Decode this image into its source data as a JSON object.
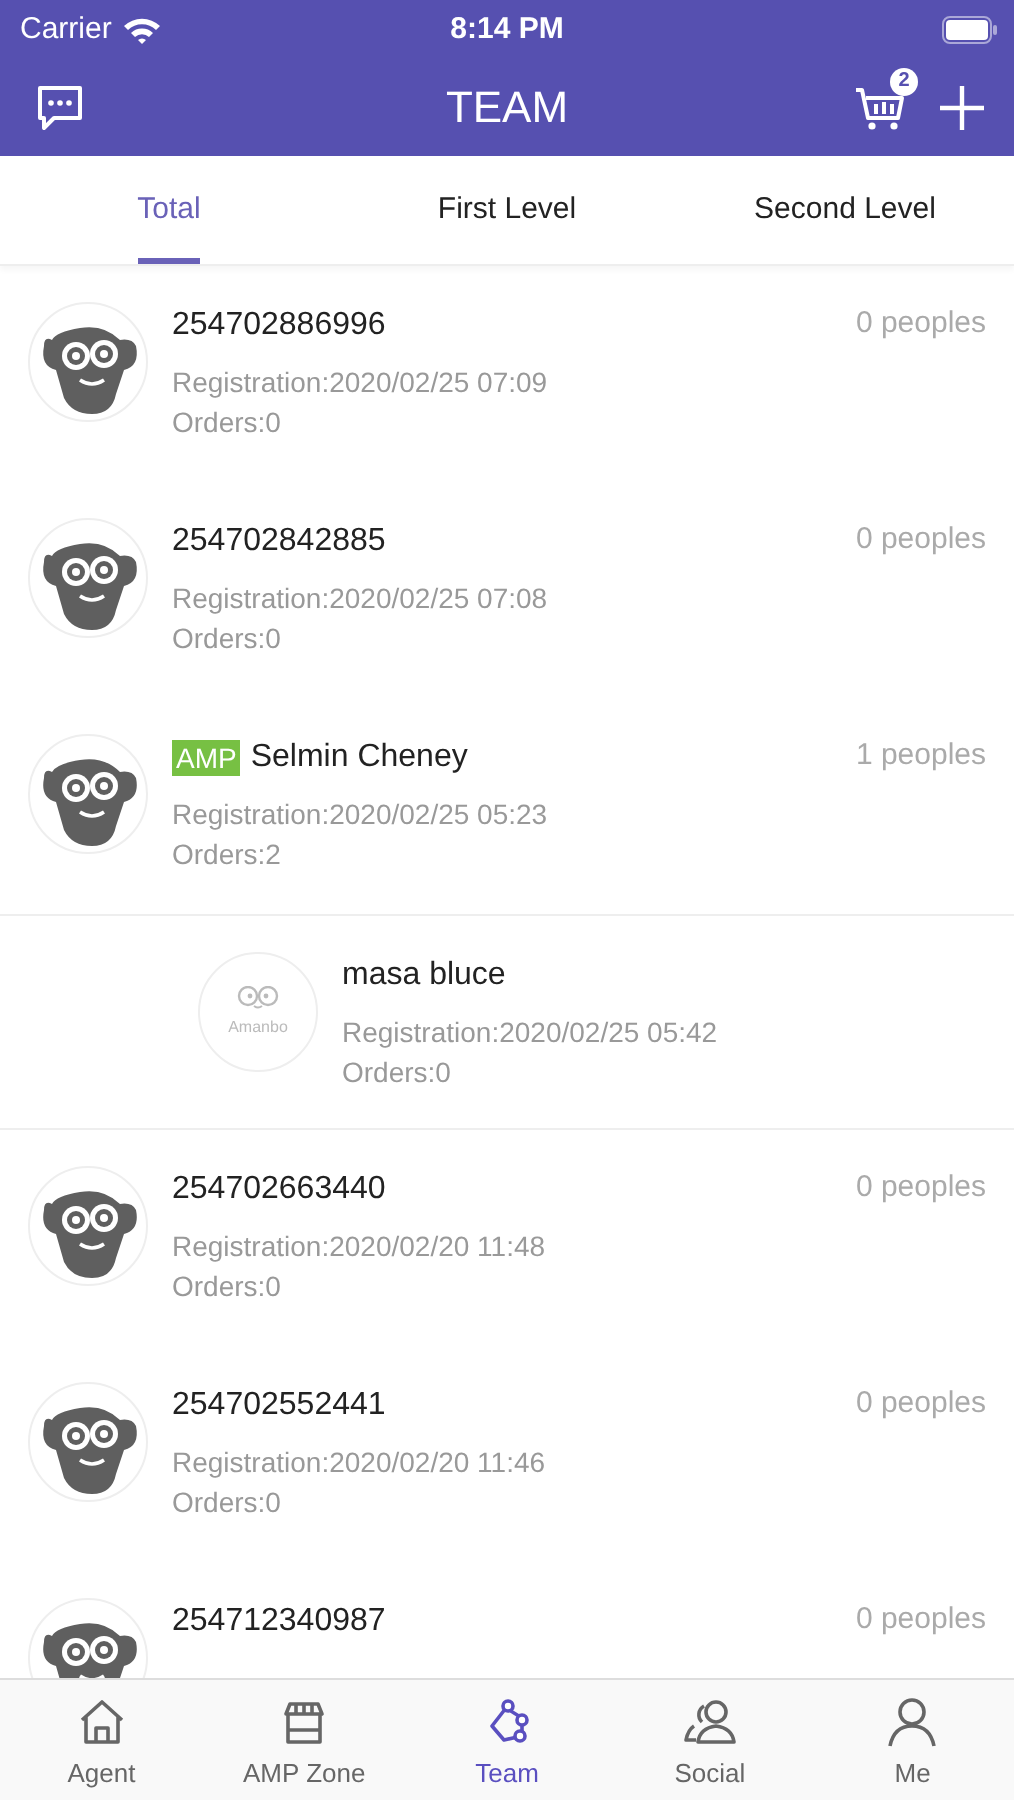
{
  "status_bar": {
    "carrier": "Carrier",
    "time": "8:14 PM"
  },
  "nav": {
    "title": "TEAM",
    "cart_count": "2"
  },
  "tabs": [
    {
      "label": "Total",
      "selected": true
    },
    {
      "label": "First Level",
      "selected": false
    },
    {
      "label": "Second Level",
      "selected": false
    }
  ],
  "members": [
    {
      "kind": "member",
      "name": "254702886996",
      "count": "0 peoples",
      "registration": "Registration:2020/02/25 07:09",
      "orders": "Orders:0"
    },
    {
      "kind": "member",
      "name": "254702842885",
      "count": "0 peoples",
      "registration": "Registration:2020/02/25 07:08",
      "orders": "Orders:0"
    },
    {
      "kind": "member",
      "badge": "AMP",
      "name": "Selmin Cheney",
      "count": "1 peoples",
      "registration": "Registration:2020/02/25 05:23",
      "orders": "Orders:2"
    },
    {
      "kind": "sub",
      "avatar_text": "Amanbo",
      "name": "masa bluce",
      "registration": "Registration:2020/02/25 05:42",
      "orders": "Orders:0"
    },
    {
      "kind": "member",
      "name": "254702663440",
      "count": "0 peoples",
      "registration": "Registration:2020/02/20 11:48",
      "orders": "Orders:0"
    },
    {
      "kind": "member",
      "name": "254702552441",
      "count": "0 peoples",
      "registration": "Registration:2020/02/20 11:46",
      "orders": "Orders:0"
    },
    {
      "kind": "member",
      "name": "254712340987",
      "count": "0 peoples"
    }
  ],
  "tab_bar": [
    {
      "label": "Agent",
      "selected": false
    },
    {
      "label": "AMP Zone",
      "selected": false
    },
    {
      "label": "Team",
      "selected": true
    },
    {
      "label": "Social",
      "selected": false
    },
    {
      "label": "Me",
      "selected": false
    }
  ]
}
